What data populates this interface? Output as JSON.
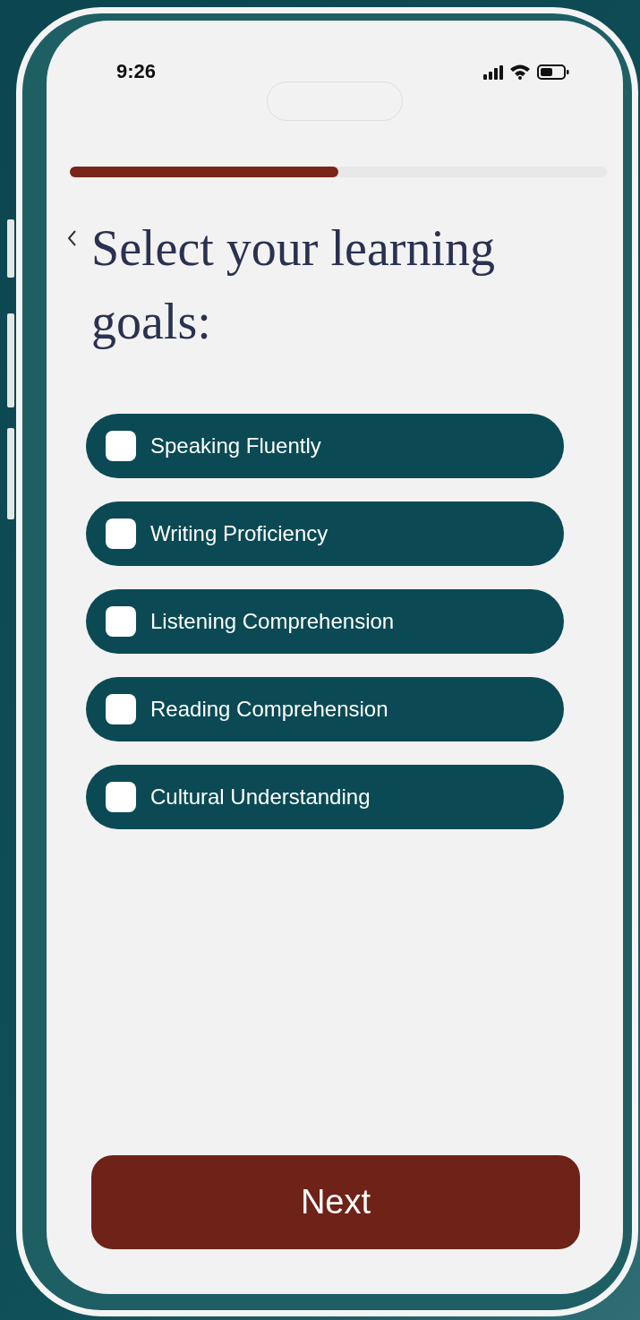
{
  "status_bar": {
    "time": "9:26"
  },
  "progress": {
    "level": 0.5
  },
  "title": "Select your learning goals:",
  "goals": [
    {
      "label": "Speaking Fluently",
      "checked": false
    },
    {
      "label": "Writing Proficiency",
      "checked": false
    },
    {
      "label": "Listening Comprehension",
      "checked": false
    },
    {
      "label": "Reading Comprehension",
      "checked": false
    },
    {
      "label": "Cultural Understanding",
      "checked": false
    }
  ],
  "next_button": "Next"
}
